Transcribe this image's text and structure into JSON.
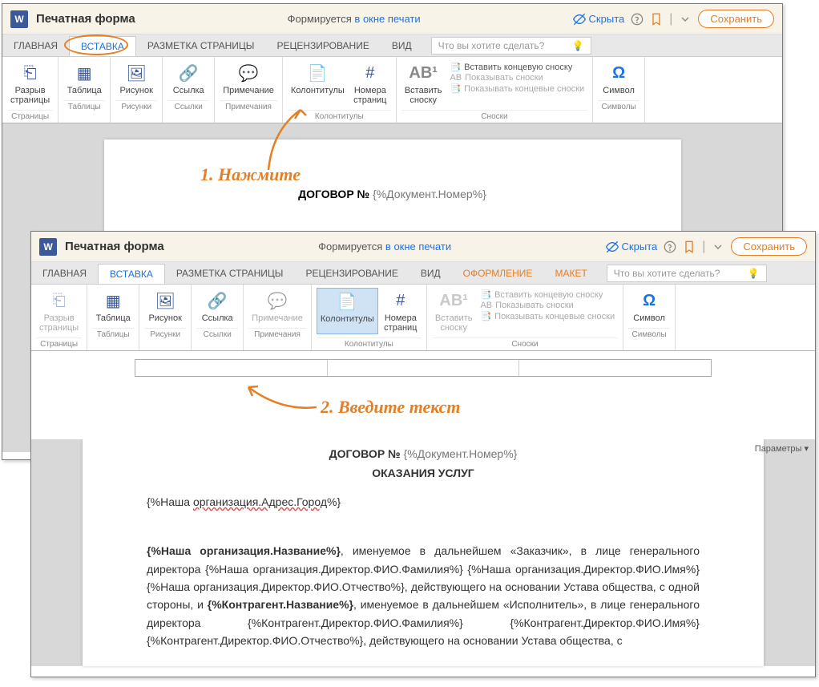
{
  "win1": {
    "title": "Печатная форма",
    "forming": "Формируется",
    "in_window": "в окне печати",
    "hidden": "Скрыта",
    "save": "Сохранить",
    "tabs": {
      "home": "ГЛАВНАЯ",
      "insert": "ВСТАВКА",
      "layout": "РАЗМЕТКА СТРАНИЦЫ",
      "review": "РЕЦЕНЗИРОВАНИЕ",
      "view": "ВИД"
    },
    "search_placeholder": "Что вы хотите сделать?",
    "ribbon": {
      "pagebreak": "Разрыв\nстраницы",
      "g_pages": "Страницы",
      "table": "Таблица",
      "g_tables": "Таблицы",
      "picture": "Рисунок",
      "g_pictures": "Рисунки",
      "link": "Ссылка",
      "g_links": "Ссылки",
      "note": "Примечание",
      "g_notes": "Примечания",
      "headers": "Колонтитулы",
      "pagenum": "Номера\nстраниц",
      "g_headers": "Колонтитулы",
      "ab": "Вставить\nсноску",
      "endnote": "Вставить концевую сноску",
      "shownotes": "Показывать сноски",
      "showend": "Показывать концевые сноски",
      "g_fn": "Сноски",
      "symbol": "Символ",
      "g_sym": "Символы"
    },
    "doc": {
      "title": "ДОГОВОР №",
      "num": "{%Документ.Номер%}"
    }
  },
  "win2": {
    "title": "Печатная форма",
    "forming": "Формируется",
    "in_window": "в окне печати",
    "hidden": "Скрыта",
    "save": "Сохранить",
    "tabs": {
      "home": "ГЛАВНАЯ",
      "insert": "ВСТАВКА",
      "layout": "РАЗМЕТКА СТРАНИЦЫ",
      "review": "РЕЦЕНЗИРОВАНИЕ",
      "view": "ВИД",
      "design": "ОФОРМЛЕНИЕ",
      "maket": "МАКЕТ"
    },
    "search_placeholder": "Что вы хотите сделать?",
    "ribbon": {
      "pagebreak": "Разрыв\nстраницы",
      "g_pages": "Страницы",
      "table": "Таблица",
      "g_tables": "Таблицы",
      "picture": "Рисунок",
      "g_pictures": "Рисунки",
      "link": "Ссылка",
      "g_links": "Ссылки",
      "note": "Примечание",
      "g_notes": "Примечания",
      "headers": "Колонтитулы",
      "pagenum": "Номера\nстраниц",
      "g_headers": "Колонтитулы",
      "ab": "Вставить\nсноску",
      "endnote": "Вставить концевую сноску",
      "shownotes": "Показывать сноски",
      "showend": "Показывать концевые сноски",
      "g_fn": "Сноски",
      "symbol": "Символ",
      "g_sym": "Символы"
    },
    "params": "Параметры",
    "doc": {
      "title": "ДОГОВОР №",
      "num": "{%Документ.Номер%}",
      "subtitle": "ОКАЗАНИЯ УСЛУГ",
      "city_pre": "{%Наша ",
      "city_u": "организация.Адрес.Город",
      "city_post": "%}",
      "body": "{%Наша организация.Название%}, именуемое в дальнейшем «Заказчик», в лице генерального директора {%Наша организация.Директор.ФИО.Фамилия%} {%Наша организация.Директор.ФИО.Имя%} {%Наша организация.Директор.ФИО.Отчество%}, действующего на основании Устава общества, с одной стороны, и {%Контрагент.Название%}, именуемое в дальнейшем «Исполнитель», в лице генерального директора {%Контрагент.Директор.ФИО.Фамилия%} {%Контрагент.Директор.ФИО.Имя%} {%Контрагент.Директор.ФИО.Отчество%}, действующего на основании Устава общества, с"
    }
  },
  "anno": {
    "step1": "1. Нажмите",
    "step2": "2. Введите текст"
  }
}
